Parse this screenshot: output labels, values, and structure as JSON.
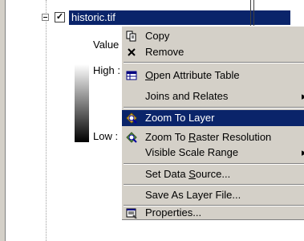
{
  "toc": {
    "layer_name": "historic.tif",
    "checked_glyph": "✓",
    "legend": {
      "value_label": "Value",
      "high_label": "High :",
      "low_label": "Low :"
    }
  },
  "menu": {
    "copy": "Copy",
    "remove": "Remove",
    "open_attribute_table": {
      "pre": "",
      "key": "O",
      "post": "pen Attribute Table"
    },
    "joins_relates": "Joins and Relates",
    "zoom_to_layer": "Zoom To Layer",
    "zoom_raster": {
      "pre": "Zoom To ",
      "key": "R",
      "post": "aster Resolution"
    },
    "visible_scale_range": "Visible Scale Range",
    "set_data_source": {
      "pre": "Set Data ",
      "key": "S",
      "post": "ource..."
    },
    "save_as_layer_file": "Save As Layer File...",
    "properties": "Properties...",
    "submenu_arrow": "▸"
  },
  "colors": {
    "highlight": "#0a246a",
    "menu_bg": "#d4d0c8"
  }
}
